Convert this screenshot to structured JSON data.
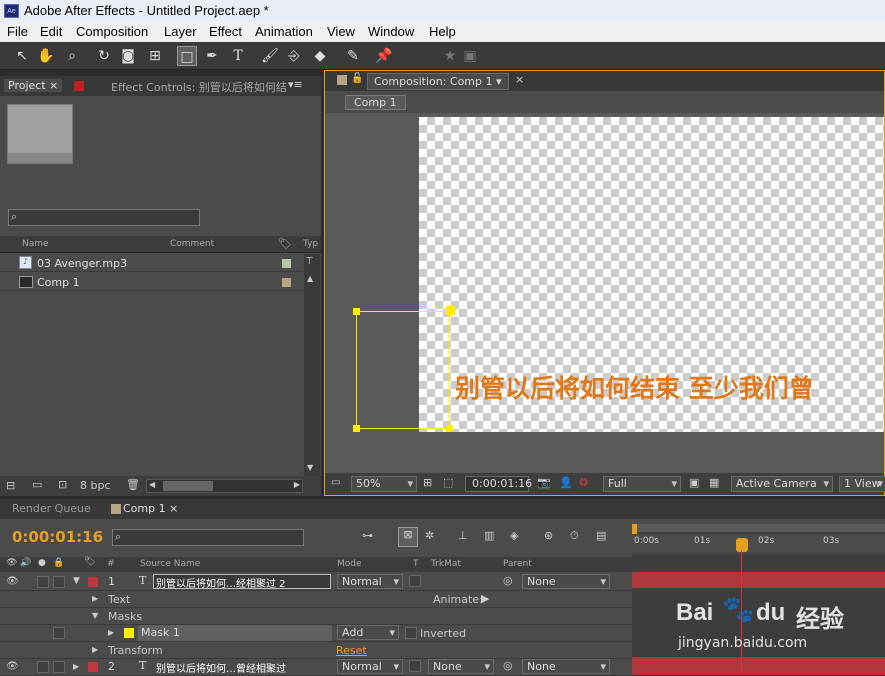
{
  "window": {
    "title": "Adobe After Effects - Untitled Project.aep *",
    "logo": "Ae"
  },
  "menu": [
    "File",
    "Edit",
    "Composition",
    "Layer",
    "Effect",
    "Animation",
    "View",
    "Window",
    "Help"
  ],
  "tools": [
    "selection-icon",
    "hand-icon",
    "zoom-icon",
    "rotate-icon",
    "camera-icon",
    "pan-behind-icon",
    "rectangle-icon",
    "pen-icon",
    "text-icon",
    "brush-icon",
    "eraser-icon",
    "roto-brush-icon",
    "puppet-icon"
  ],
  "project": {
    "tab": "Project",
    "effect_tab": "Effect Controls: 别管以后将如何结",
    "search_placeholder": "",
    "columns": {
      "name": "Name",
      "comment": "Comment",
      "type": "Typ"
    },
    "items": [
      {
        "name": "03 Avenger.mp3",
        "color": "#b5c9a8"
      },
      {
        "name": "Comp 1",
        "color": "#b8a585"
      }
    ],
    "bpc": "8 bpc"
  },
  "comp": {
    "tab": "Composition: Comp 1",
    "breadcrumb": "Comp 1",
    "text": "别管以后将如何结束 至少我们曾",
    "zoom": "50%",
    "timecode": "0:00:01:16",
    "resolution": "Full",
    "camera": "Active Camera",
    "view": "1 View"
  },
  "timeline": {
    "tab_render": "Render Queue",
    "tab_comp": "Comp 1",
    "timecode": "0:00:01:16",
    "columns": {
      "num": "#",
      "source": "Source Name",
      "mode": "Mode",
      "t": "T",
      "trkmat": "TrkMat",
      "parent": "Parent"
    },
    "ruler": [
      "0:00s",
      "01s",
      "02s",
      "03s"
    ],
    "layer1": {
      "num": "1",
      "name": "别管以后将如何…经相聚过 2",
      "mode": "Normal",
      "parent": "None"
    },
    "text_prop": "Text",
    "animate": "Animate:",
    "masks": "Masks",
    "mask1": "Mask 1",
    "mask_mode": "Add",
    "inverted": "Inverted",
    "transform": "Transform",
    "reset": "Reset",
    "layer2": {
      "num": "2",
      "name": "别管以后将如何…曾经相聚过",
      "mode": "Normal",
      "trkmat": "None",
      "parent": "None"
    }
  },
  "watermark": {
    "brand": "Bai",
    "paw": "du",
    "cn": "经验",
    "url": "jingyan.baidu.com"
  },
  "colors": {
    "accent": "#e6a020",
    "text_orange": "#e07818",
    "mask_yellow": "#ffee00",
    "layer_red": "#c0383b"
  }
}
